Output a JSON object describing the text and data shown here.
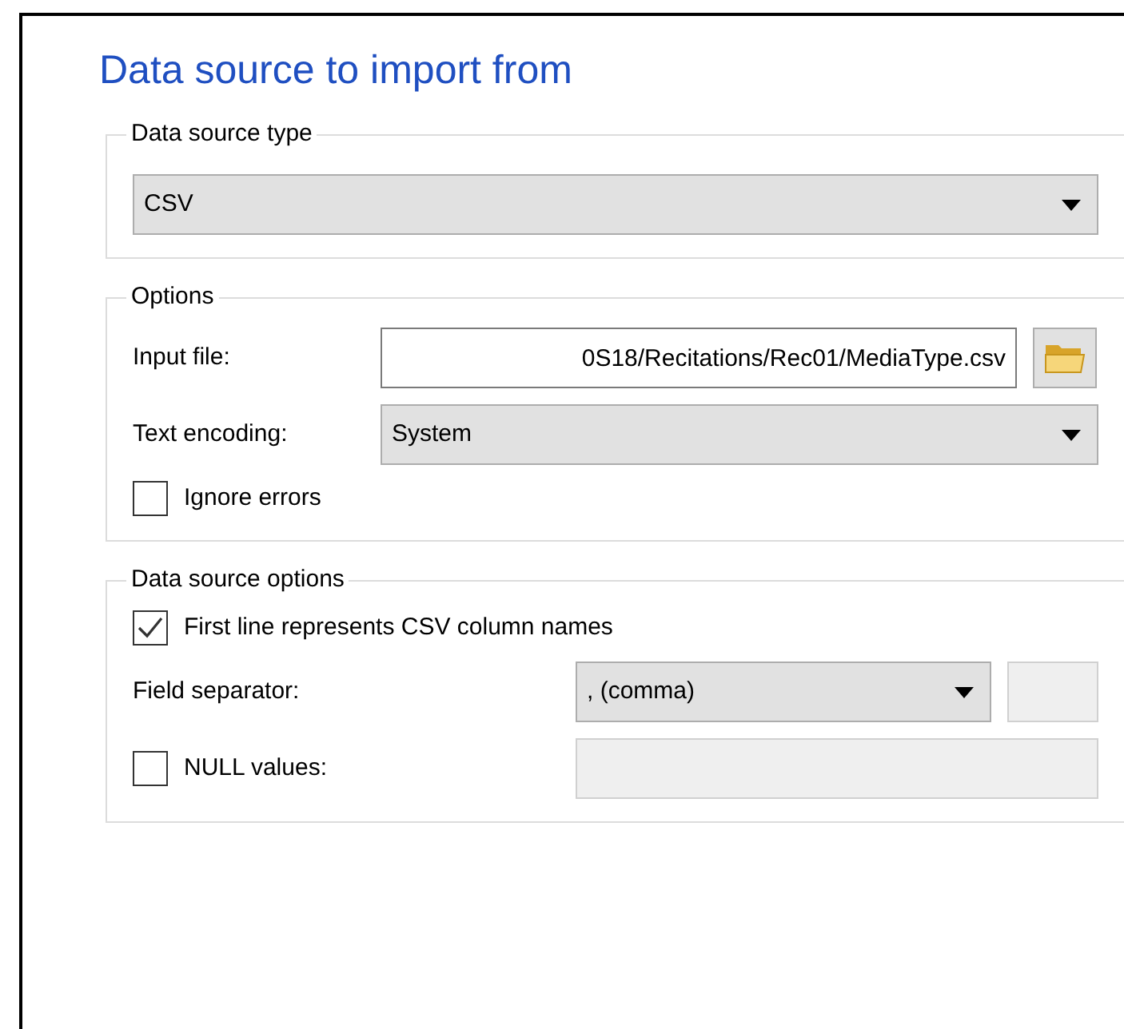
{
  "heading": "Data source to import from",
  "groups": [
    {
      "title": "Data source type",
      "rows": [
        {
          "kind": "combo",
          "value": "CSV"
        }
      ]
    },
    {
      "title": "Options",
      "rows": [
        {
          "kind": "file",
          "label": "Input file:",
          "value": "0S18/Recitations/Rec01/MediaType.csv"
        },
        {
          "kind": "labeled-combo",
          "label": "Text encoding:",
          "value": "System"
        },
        {
          "kind": "checkbox",
          "label": "Ignore errors",
          "checked": false
        }
      ]
    },
    {
      "title": "Data source options",
      "rows": [
        {
          "kind": "checkbox",
          "label": "First line represents CSV column names",
          "checked": true
        },
        {
          "kind": "separator",
          "label": "Field separator:",
          "value": ", (comma)"
        },
        {
          "kind": "check-field",
          "label": "NULL values:",
          "checked": false
        }
      ]
    }
  ]
}
